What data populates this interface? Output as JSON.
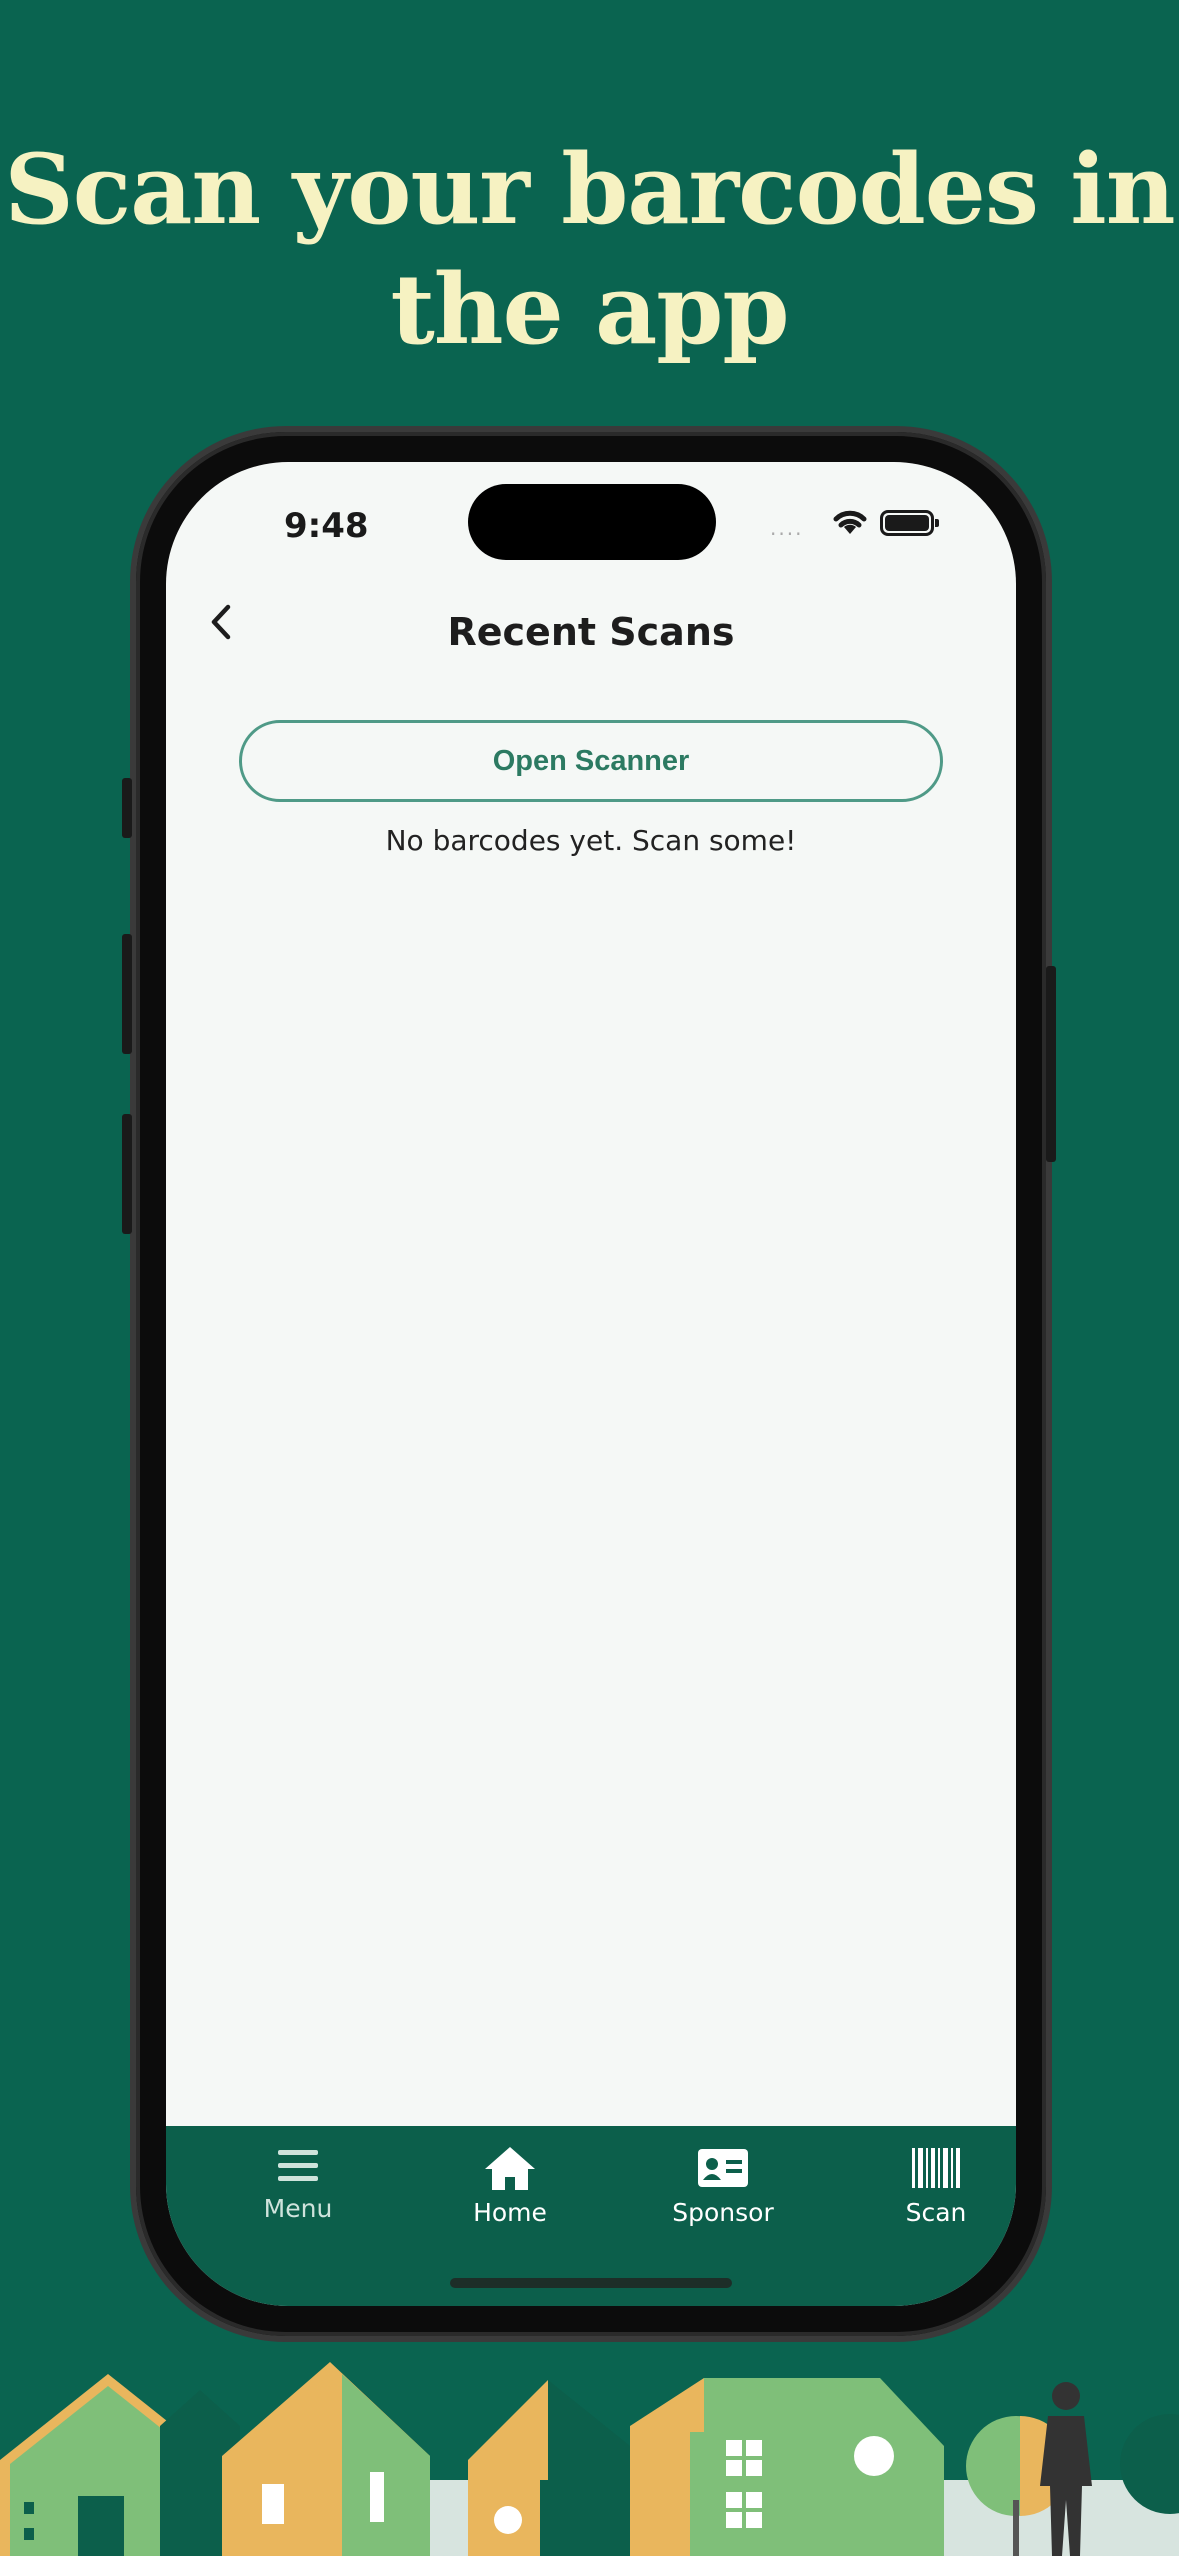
{
  "headline": {
    "line1": "Scan your barcodes in",
    "line2": "the app"
  },
  "status_bar": {
    "time": "9:48"
  },
  "header": {
    "title": "Recent Scans"
  },
  "main": {
    "open_scanner_label": "Open Scanner",
    "empty_message": "No barcodes yet. Scan some!"
  },
  "tabbar": {
    "items": [
      {
        "label": "Menu",
        "icon": "menu-icon"
      },
      {
        "label": "Home",
        "icon": "home-icon"
      },
      {
        "label": "Sponsor",
        "icon": "id-card-icon"
      },
      {
        "label": "Scan",
        "icon": "barcode-icon"
      }
    ]
  },
  "colors": {
    "background": "#0a6450",
    "headline": "#f6f2c2",
    "accent": "#2c7a62",
    "tabbar": "#0c5f4b"
  }
}
